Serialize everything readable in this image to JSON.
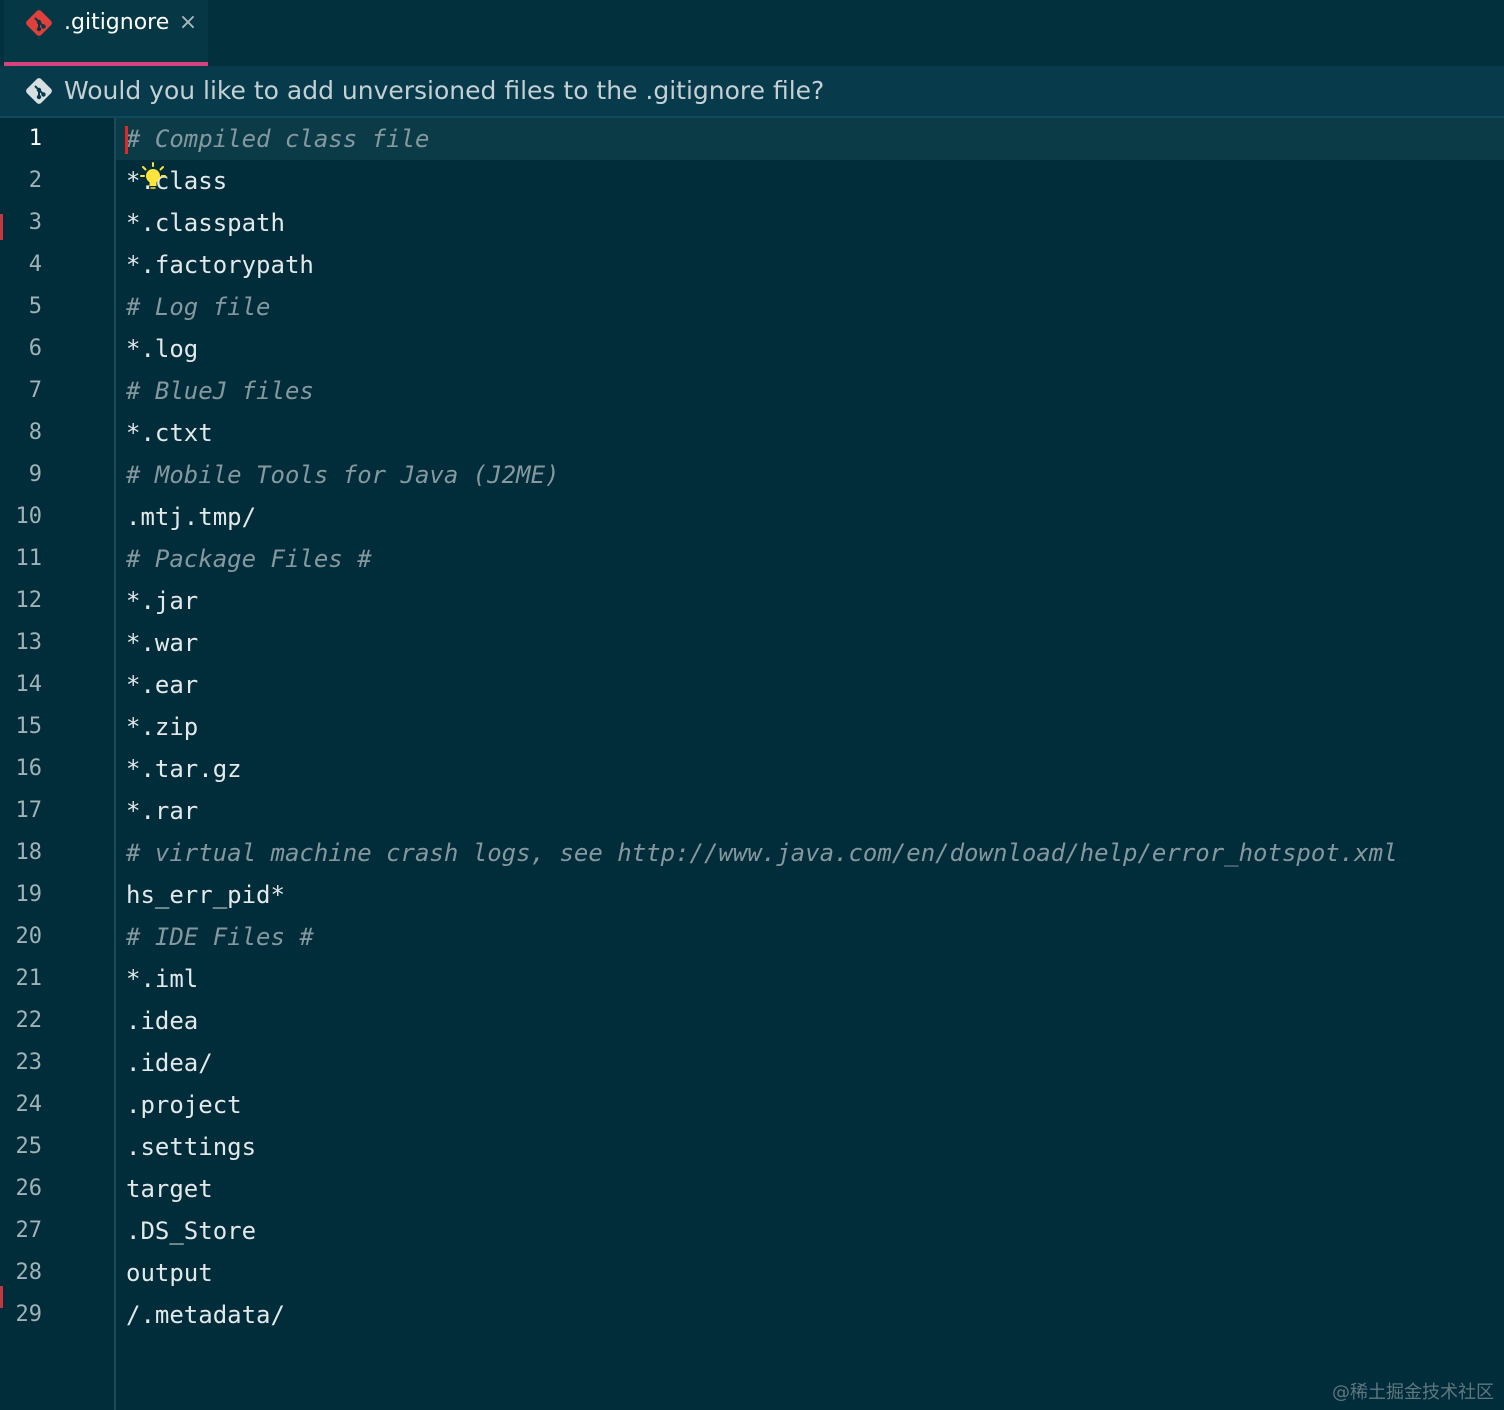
{
  "tab": {
    "label": ".gitignore",
    "close_glyph": "×",
    "icon": "git-icon"
  },
  "banner": {
    "icon": "git-icon",
    "text": "Would you like to add unversioned files to the .gitignore file?"
  },
  "editor": {
    "current_line": 1,
    "lines": [
      {
        "n": "1",
        "text": "# Compiled class file",
        "comment": true
      },
      {
        "n": "2",
        "text": "*.class",
        "comment": false
      },
      {
        "n": "3",
        "text": "*.classpath",
        "comment": false
      },
      {
        "n": "4",
        "text": "*.factorypath",
        "comment": false
      },
      {
        "n": "5",
        "text": "# Log file",
        "comment": true
      },
      {
        "n": "6",
        "text": "*.log",
        "comment": false
      },
      {
        "n": "7",
        "text": "# BlueJ files",
        "comment": true
      },
      {
        "n": "8",
        "text": "*.ctxt",
        "comment": false
      },
      {
        "n": "9",
        "text": "# Mobile Tools for Java (J2ME)",
        "comment": true
      },
      {
        "n": "10",
        "text": ".mtj.tmp/",
        "comment": false
      },
      {
        "n": "11",
        "text": "# Package Files #",
        "comment": true
      },
      {
        "n": "12",
        "text": "*.jar",
        "comment": false
      },
      {
        "n": "13",
        "text": "*.war",
        "comment": false
      },
      {
        "n": "14",
        "text": "*.ear",
        "comment": false
      },
      {
        "n": "15",
        "text": "*.zip",
        "comment": false
      },
      {
        "n": "16",
        "text": "*.tar.gz",
        "comment": false
      },
      {
        "n": "17",
        "text": "*.rar",
        "comment": false
      },
      {
        "n": "18",
        "text": "# virtual machine crash logs, see http://www.java.com/en/download/help/error_hotspot.xml",
        "comment": true
      },
      {
        "n": "19",
        "text": "hs_err_pid*",
        "comment": false
      },
      {
        "n": "20",
        "text": "# IDE Files #",
        "comment": true
      },
      {
        "n": "21",
        "text": "*.iml",
        "comment": false
      },
      {
        "n": "22",
        "text": ".idea",
        "comment": false
      },
      {
        "n": "23",
        "text": ".idea/",
        "comment": false
      },
      {
        "n": "24",
        "text": ".project",
        "comment": false
      },
      {
        "n": "25",
        "text": ".settings",
        "comment": false
      },
      {
        "n": "26",
        "text": "target",
        "comment": false
      },
      {
        "n": "27",
        "text": ".DS_Store",
        "comment": false
      },
      {
        "n": "28",
        "text": "output",
        "comment": false
      },
      {
        "n": "29",
        "text": "/.metadata/",
        "comment": false
      }
    ]
  },
  "intention_icon": "lightbulb-icon",
  "watermark": "@稀土掘金技术社区",
  "colors": {
    "background": "#012c39",
    "tab_underline": "#d7437a",
    "git_icon": "#e0403c",
    "caret": "#e2272c",
    "comment": "#8598a0",
    "text": "#e3e8ea",
    "bulb": "#ffe53b"
  }
}
